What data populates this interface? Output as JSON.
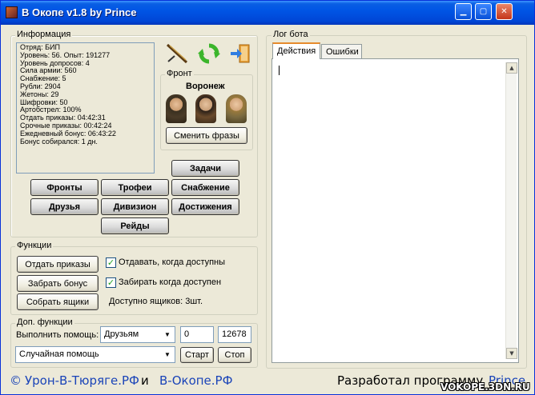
{
  "window": {
    "title": "В Окопе v1.8 by Prince",
    "controls": {
      "minimize": "▁",
      "maximize": "▢",
      "close": "✕"
    }
  },
  "info": {
    "legend": "Информация",
    "lines": [
      "Отряд: БИП",
      "Уровень: 56. Опыт: 191277",
      "Уровень допросов: 4",
      "Сила армии: 560",
      "Снабжение: 5",
      "Рубли: 2904",
      "Жетоны: 29",
      "Шифровки: 50",
      "Артобстрел: 100%",
      "Отдать приказы: 04:42:31",
      "Срочные приказы: 00:42:24",
      "Ежедневный бонус: 06:43:22",
      "Бонус собирался: 1 дн."
    ]
  },
  "front": {
    "legend": "Фронт",
    "city": "Воронеж",
    "change_phrases": "Сменить фразы"
  },
  "nav_buttons": {
    "tasks": "Задачи",
    "fronts": "Фронты",
    "trophies": "Трофеи",
    "supply": "Снабжение",
    "friends": "Друзья",
    "division": "Дивизион",
    "achievements": "Достижения",
    "raids": "Рейды"
  },
  "functions": {
    "legend": "Функции",
    "give_orders": "Отдать приказы",
    "collect_bonus": "Забрать бонус",
    "collect_boxes": "Собрать ящики",
    "auto_orders_label": "Отдавать, когда доступны",
    "auto_orders_checked": true,
    "auto_bonus_label": "Забирать когда доступен",
    "auto_bonus_checked": true,
    "boxes_available": "Доступно ящиков: 3шт."
  },
  "extra": {
    "legend": "Доп. функции",
    "help_label": "Выполнить помощь:",
    "help_target": "Друзьям",
    "count_value": "0",
    "id_value": "12678",
    "help_type": "Случайная помощь",
    "start": "Старт",
    "stop": "Стоп"
  },
  "log": {
    "legend": "Лог бота",
    "tabs": [
      "Действия",
      "Ошибки"
    ],
    "active_tab": 0
  },
  "footer": {
    "copyright": "©",
    "link1": "Урон-В-Тюряге.РФ",
    "conj": "и",
    "link2": "В-Окопе.РФ",
    "dev_label": "Разработал программу",
    "dev_name": "Prince",
    "watermark": "VOKOPE.3DN.RU"
  },
  "colors": {
    "titlebar": "#0055e5",
    "link": "#1a44b8",
    "check": "#21a121"
  }
}
